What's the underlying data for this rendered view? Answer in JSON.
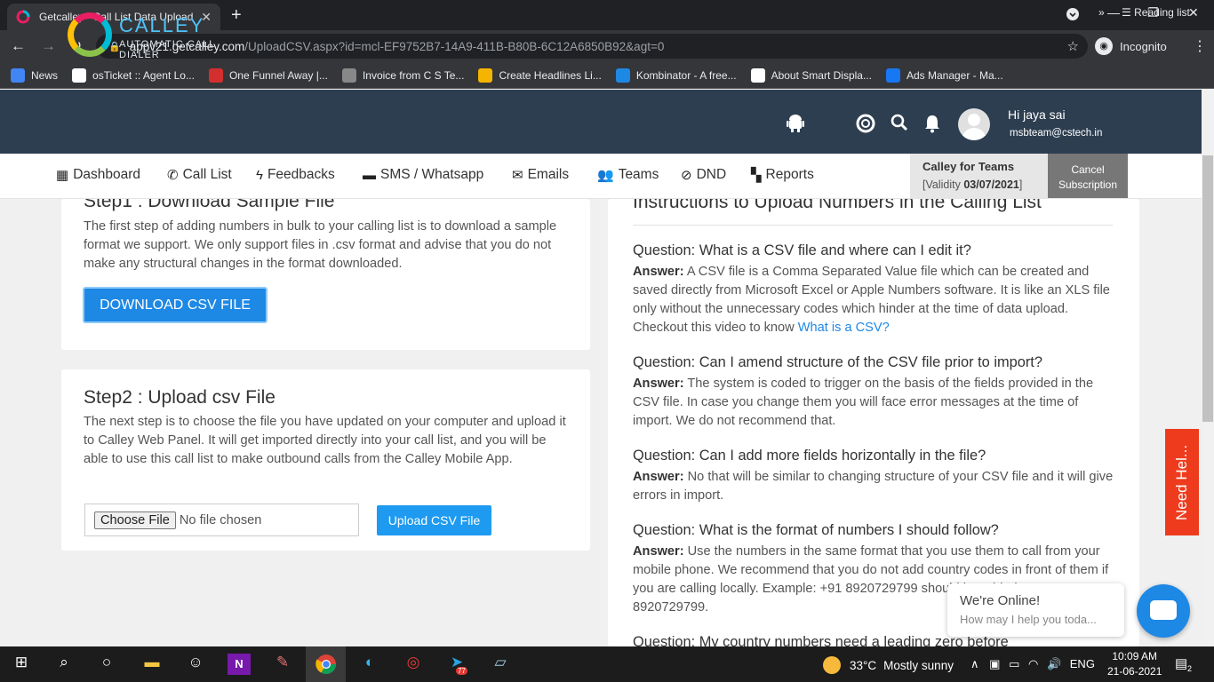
{
  "browser": {
    "tab_title": "Getcalley - Call List Data Upload",
    "url_host": "appv21.getcalley.com",
    "url_path": "/UploadCSV.aspx?id=mcl-EF9752B7-14A9-411B-B80B-6C12A6850B92&agt=0",
    "incognito_label": "Incognito",
    "bookmarks": [
      {
        "label": "News",
        "icon": "news-icon",
        "color": "#4285f4"
      },
      {
        "label": "osTicket :: Agent Lo...",
        "icon": "osticket-icon",
        "color": "#ffffff"
      },
      {
        "label": "One Funnel Away |...",
        "icon": "funnel-icon",
        "color": "#d32f2f"
      },
      {
        "label": "Invoice from C S Te...",
        "icon": "invoice-icon",
        "color": "#888888"
      },
      {
        "label": "Create Headlines Li...",
        "icon": "headline-icon",
        "color": "#f4b400"
      },
      {
        "label": "Kombinator - A free...",
        "icon": "kombinator-icon",
        "color": "#1e88e5"
      },
      {
        "label": "About Smart Displa...",
        "icon": "google-icon",
        "color": "#ffffff"
      },
      {
        "label": "Ads Manager - Ma...",
        "icon": "facebook-icon",
        "color": "#1877f2"
      }
    ],
    "bookmarks_more": "»",
    "reading_list": "Reading list"
  },
  "app": {
    "logo_name": "CALLEY",
    "logo_tagline": "AUTOMATIC CALL DIALER",
    "greeting": "Hi jaya sai",
    "email": "msbteam@cstech.in",
    "nav": [
      "Dashboard",
      "Call List",
      "Feedbacks",
      "SMS / Whatsapp",
      "Emails",
      "Teams",
      "DND",
      "Reports"
    ],
    "plan_title": "Calley for Teams",
    "validity_label": "[Validity ",
    "validity_date": "03/07/2021",
    "validity_close": "]",
    "cancel_line1": "Cancel",
    "cancel_line2": "Subscription"
  },
  "step1": {
    "title": "Step1 : Download Sample File",
    "text": "The first step of adding numbers in bulk to your calling list is to download a sample format we support. We only support files in .csv format and advise that you do not make any structural changes in the format downloaded.",
    "button": "DOWNLOAD CSV FILE"
  },
  "step2": {
    "title": "Step2 : Upload csv File",
    "text": "The next step is to choose the file you have updated on your computer and upload it to Calley Web Panel. It will get imported directly into your call list, and you will be able to use this call list to make outbound calls from the Calley Mobile App.",
    "choose_file": "Choose File",
    "no_file": "No file chosen",
    "upload_button": "Upload CSV File"
  },
  "instructions": {
    "title": "Instructions to Upload Numbers in the Calling List",
    "answer_label": "Answer:",
    "items": [
      {
        "q": "Question: What is a CSV file and where can I edit it?",
        "a": " A CSV file is a Comma Separated Value file which can be created and saved directly from Microsoft Excel or Apple Numbers software. It is like an XLS file only without the unnecessary codes which hinder at the time of data upload. Checkout this video to know ",
        "link": "What is a CSV?"
      },
      {
        "q": "Question: Can I amend structure of the CSV file prior to import?",
        "a": " The system is coded to trigger on the basis of the fields provided in the CSV file. In case you change them you will face error messages at the time of import. We do not recommend that."
      },
      {
        "q": "Question: Can I add more fields horizontally in the file?",
        "a": " No that will be similar to changing structure of your CSV file and it will give errors in import."
      },
      {
        "q": "Question: What is the format of numbers I should follow?",
        "a": " Use the numbers in the same format that you use them to call from your mobile phone. We recommend that you do not add country codes in front of them if you are calling locally. Example: +91 8920729799 should be added as 8920729799."
      },
      {
        "q": "Question: My country numbers need a leading zero before"
      }
    ]
  },
  "chat": {
    "need_help": "Need Hel...",
    "online": "We're Online!",
    "prompt": "How may I help you toda..."
  },
  "taskbar": {
    "temperature": "33°C",
    "weather": "Mostly sunny",
    "language": "ENG",
    "time": "10:09 AM",
    "date": "21-06-2021",
    "telegram_badge": "77",
    "notifications": "2"
  }
}
